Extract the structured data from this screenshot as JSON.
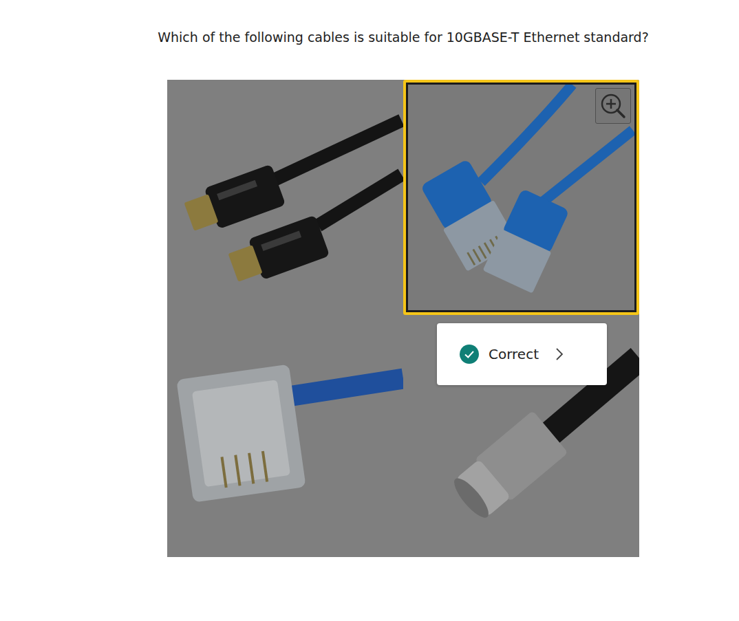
{
  "question": "Which of the following cables is suitable for 10GBASE-T Ethernet standard?",
  "options": [
    {
      "kind": "hdmi",
      "selected": false
    },
    {
      "kind": "rj45",
      "selected": true
    },
    {
      "kind": "rj11",
      "selected": false
    },
    {
      "kind": "coax",
      "selected": false
    }
  ],
  "feedback": {
    "label": "Correct",
    "correct": true
  }
}
